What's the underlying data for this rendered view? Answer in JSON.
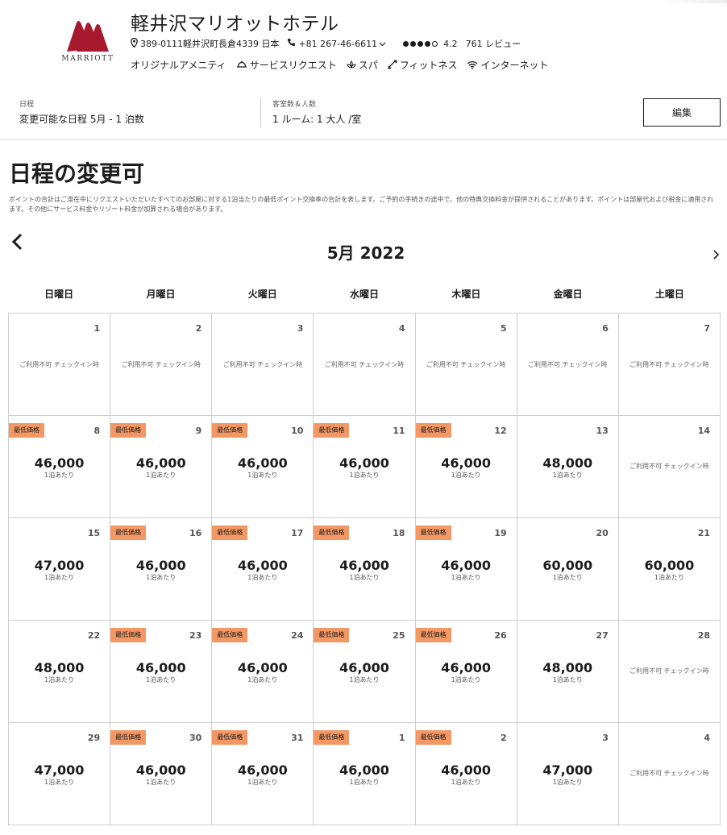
{
  "brand": {
    "logo_text": "MARRIOTT",
    "accent": "#a6192e"
  },
  "hotel": {
    "name": "軽井沢マリオットホテル",
    "address": "389-0111軽井沢町長倉4339 日本",
    "phone": "+81 267-46-6611",
    "rating": "4.2",
    "reviews": "761 レビュー",
    "stars": {
      "filled": 4,
      "total": 5
    },
    "amenities": [
      {
        "label": "オリジナルアメニティ",
        "icon": ""
      },
      {
        "label": "サービスリクエスト",
        "icon": "bell-icon"
      },
      {
        "label": "スパ",
        "icon": "spa-icon"
      },
      {
        "label": "フィットネス",
        "icon": "fitness-icon"
      },
      {
        "label": "インターネット",
        "icon": "wifi-icon"
      }
    ]
  },
  "search": {
    "dates_label": "日程",
    "dates_value": "変更可能な日程 5月 - 1 泊数",
    "rooms_label": "客室数＆人数",
    "rooms_value": "1 ルーム: 1 大人 /室",
    "edit_label": "編集"
  },
  "page": {
    "title": "日程の変更可",
    "disclaimer": "ポイントの合計はご滞在中にリクエストいただいたすべてのお部屋に対する1泊当たりの最低ポイント交換率の合計を表します。ご予約の手続きの途中で、他の特典交換料金が提供されることがあります。ポイントは部屋代および税金に適用されます。その他にサービス料金やリゾート料金が加算される場合があります。"
  },
  "calendar": {
    "month": "5月 2022",
    "weekdays": [
      "日曜日",
      "月曜日",
      "火曜日",
      "水曜日",
      "木曜日",
      "金曜日",
      "土曜日"
    ],
    "badge_color": "#f39864",
    "days": [
      {
        "day": "1",
        "unavailable": "ご利用不可 チェックイン時"
      },
      {
        "day": "2",
        "unavailable": "ご利用不可 チェックイン時"
      },
      {
        "day": "3",
        "unavailable": "ご利用不可 チェックイン時"
      },
      {
        "day": "4",
        "unavailable": "ご利用不可 チェックイン時"
      },
      {
        "day": "5",
        "unavailable": "ご利用不可 チェックイン時"
      },
      {
        "day": "6",
        "unavailable": "ご利用不可 チェックイン時"
      },
      {
        "day": "7",
        "unavailable": "ご利用不可 チェックイン時"
      },
      {
        "day": "8",
        "price": "46,000",
        "per": "1泊あたり",
        "badge": "最低価格"
      },
      {
        "day": "9",
        "price": "46,000",
        "per": "1泊あたり",
        "badge": "最低価格"
      },
      {
        "day": "10",
        "price": "46,000",
        "per": "1泊あたり",
        "badge": "最低価格"
      },
      {
        "day": "11",
        "price": "46,000",
        "per": "1泊あたり",
        "badge": "最低価格"
      },
      {
        "day": "12",
        "price": "46,000",
        "per": "1泊あたり",
        "badge": "最低価格"
      },
      {
        "day": "13",
        "price": "48,000",
        "per": "1泊あたり"
      },
      {
        "day": "14",
        "unavailable": "ご利用不可 チェックイン時"
      },
      {
        "day": "15",
        "price": "47,000",
        "per": "1泊あたり"
      },
      {
        "day": "16",
        "price": "46,000",
        "per": "1泊あたり",
        "badge": "最低価格"
      },
      {
        "day": "17",
        "price": "46,000",
        "per": "1泊あたり",
        "badge": "最低価格"
      },
      {
        "day": "18",
        "price": "46,000",
        "per": "1泊あたり",
        "badge": "最低価格"
      },
      {
        "day": "19",
        "price": "46,000",
        "per": "1泊あたり",
        "badge": "最低価格"
      },
      {
        "day": "20",
        "price": "60,000",
        "per": "1泊あたり"
      },
      {
        "day": "21",
        "price": "60,000",
        "per": "1泊あたり"
      },
      {
        "day": "22",
        "price": "48,000",
        "per": "1泊あたり"
      },
      {
        "day": "23",
        "price": "46,000",
        "per": "1泊あたり",
        "badge": "最低価格"
      },
      {
        "day": "24",
        "price": "46,000",
        "per": "1泊あたり",
        "badge": "最低価格"
      },
      {
        "day": "25",
        "price": "46,000",
        "per": "1泊あたり",
        "badge": "最低価格"
      },
      {
        "day": "26",
        "price": "46,000",
        "per": "1泊あたり",
        "badge": "最低価格"
      },
      {
        "day": "27",
        "price": "48,000",
        "per": "1泊あたり"
      },
      {
        "day": "28",
        "unavailable": "ご利用不可 チェックイン時"
      },
      {
        "day": "29",
        "price": "47,000",
        "per": "1泊あたり"
      },
      {
        "day": "30",
        "price": "46,000",
        "per": "1泊あたり",
        "badge": "最低価格"
      },
      {
        "day": "31",
        "price": "46,000",
        "per": "1泊あたり",
        "badge": "最低価格"
      },
      {
        "day": "1",
        "price": "46,000",
        "per": "1泊あたり",
        "badge": "最低価格"
      },
      {
        "day": "2",
        "price": "46,000",
        "per": "1泊あたり",
        "badge": "最低価格"
      },
      {
        "day": "3",
        "price": "47,000",
        "per": "1泊あたり"
      },
      {
        "day": "4",
        "unavailable": "ご利用不可 チェックイン時"
      }
    ]
  }
}
